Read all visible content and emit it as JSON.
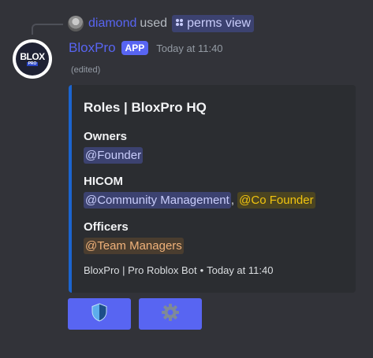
{
  "reply": {
    "user": "diamond",
    "action": "used",
    "command": "perms view",
    "command_icon": "slash-command-icon"
  },
  "message": {
    "author": "BloxPro",
    "badge": "APP",
    "timestamp": "Today at 11:40",
    "edited_label": "(edited)",
    "avatar": {
      "top": "BLOX",
      "bottom": "PRO"
    }
  },
  "embed": {
    "accent_color": "#1b64cf",
    "title": "Roles | BloxPro HQ",
    "fields": [
      {
        "name": "Owners",
        "roles": [
          {
            "label": "@Founder",
            "color": "#c9cdfb"
          }
        ]
      },
      {
        "name": "HICOM",
        "roles": [
          {
            "label": "@Community Management",
            "color": "#c9cdfb"
          },
          {
            "label": "@Co Founder",
            "color": "#f1c40f"
          }
        ]
      },
      {
        "name": "Officers",
        "roles": [
          {
            "label": "@Team Managers",
            "color": "#f0b27a"
          }
        ]
      }
    ],
    "footer": {
      "text": "BloxPro | Pro Roblox Bot",
      "separator": "•",
      "timestamp": "Today at 11:40"
    }
  },
  "buttons": [
    {
      "icon": "shield-icon"
    },
    {
      "icon": "gear-icon"
    }
  ],
  "colors": {
    "blurple": "#5865f2",
    "background": "#323339",
    "embed_bg": "#2b2d31"
  }
}
